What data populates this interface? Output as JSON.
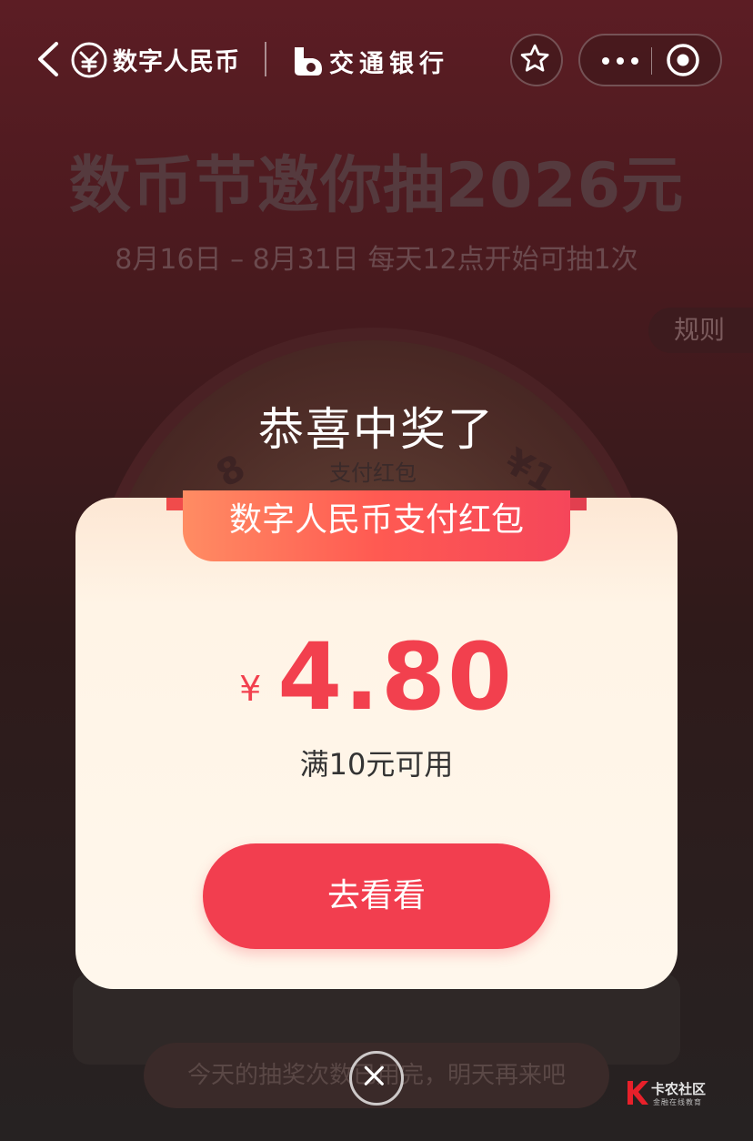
{
  "nav": {
    "app_name": "数字人民币",
    "bank_name": "交通银行"
  },
  "background": {
    "title": "数币节邀你抽2026元",
    "subtitle": "8月16日 – 8月31日  每天12点开始可抽1次",
    "rules_label": "规则",
    "wheel_prize_label": "支付红包",
    "wheel_item_left": "8",
    "wheel_item_right": "¥1",
    "status_text": "今天的抽奖次数已用完，明天再来吧"
  },
  "modal": {
    "congrats": "恭喜中奖了",
    "ribbon_label": "数字人民币支付红包",
    "currency": "¥",
    "amount": "4.80",
    "condition": "满10元可用",
    "cta_label": "去看看"
  },
  "watermark": {
    "name": "卡农社区",
    "sub": "金融在线教育"
  },
  "colors": {
    "accent": "#f23e4f",
    "ribbon_start": "#ff8c63",
    "ribbon_end": "#f5465a",
    "modal_bg": "#fff7ec"
  },
  "icons": [
    "back-icon",
    "e-cny-logo-icon",
    "bocom-logo-icon",
    "star-icon",
    "more-dots-icon",
    "close-miniprogram-icon",
    "close-icon"
  ]
}
